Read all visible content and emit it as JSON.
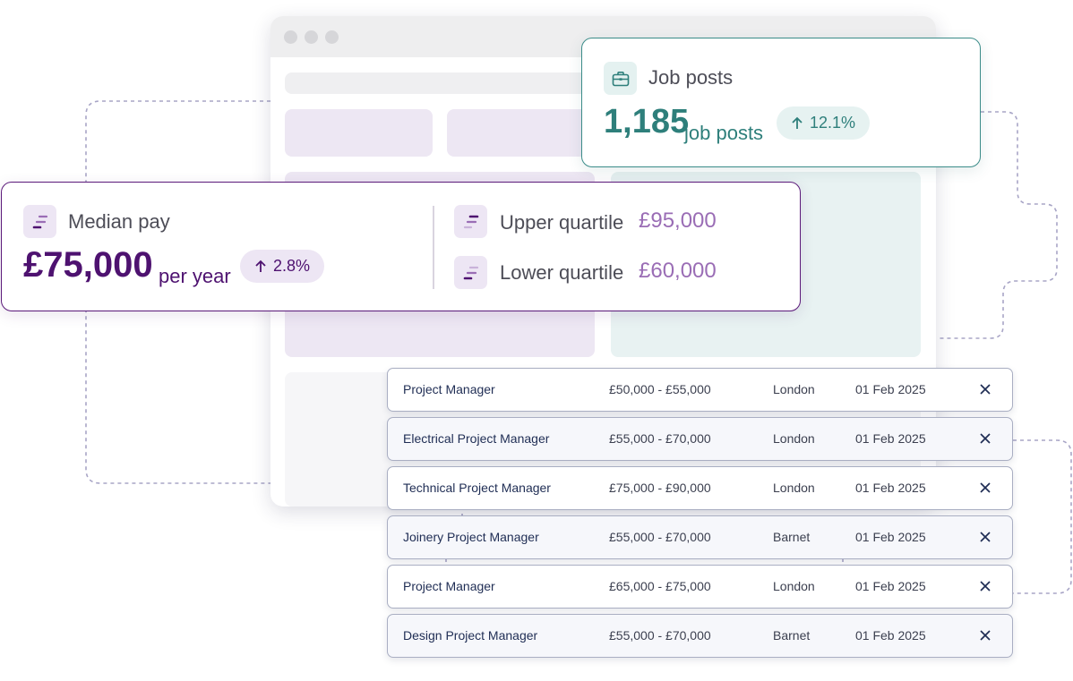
{
  "job_posts_card": {
    "title": "Job posts",
    "count": "1,185",
    "unit": "job posts",
    "change": "12.1%",
    "icon": "briefcase-icon",
    "accent": "#2e7f7b"
  },
  "median_pay_card": {
    "title": "Median pay",
    "value": "£75,000",
    "unit": "per year",
    "change": "2.8%",
    "upper_quartile_label": "Upper quartile",
    "upper_quartile_value": "£95,000",
    "lower_quartile_label": "Lower quartile",
    "lower_quartile_value": "£60,000",
    "icon": "bar-lines-icon",
    "accent": "#4e1270"
  },
  "job_rows": [
    {
      "title": "Project Manager",
      "salary": "£50,000 - £55,000",
      "location": "London",
      "date": "01 Feb 2025"
    },
    {
      "title": "Electrical Project Manager",
      "salary": "£55,000 - £70,000",
      "location": "London",
      "date": "01 Feb 2025"
    },
    {
      "title": "Technical Project Manager",
      "salary": "£75,000 - £90,000",
      "location": "London",
      "date": "01 Feb 2025"
    },
    {
      "title": "Joinery Project Manager",
      "salary": "£55,000 - £70,000",
      "location": "Barnet",
      "date": "01 Feb 2025"
    },
    {
      "title": "Project Manager",
      "salary": "£65,000 - £75,000",
      "location": "London",
      "date": "01 Feb 2025"
    },
    {
      "title": "Design Project Manager",
      "salary": "£55,000 - £70,000",
      "location": "Barnet",
      "date": "01 Feb 2025"
    }
  ]
}
